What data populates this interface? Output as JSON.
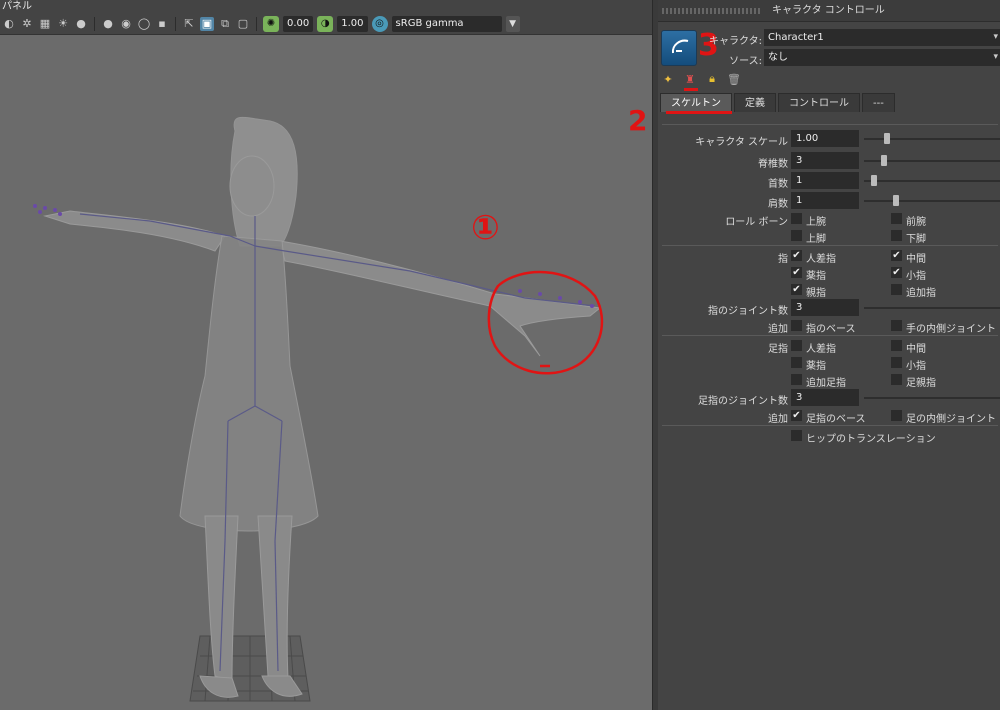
{
  "viewport": {
    "menu_label": "パネル",
    "exposure_value": "0.00",
    "gamma_value": "1.00",
    "colorspace": "sRGB gamma"
  },
  "panel": {
    "title": "キャラクタ コントロール",
    "character_label": "キャラクタ:",
    "character_value": "Character1",
    "source_label": "ソース:",
    "source_value": "なし",
    "tabs": [
      "スケルトン",
      "定義",
      "コントロール",
      "---"
    ],
    "active_tab": "スケルトン"
  },
  "skeleton": {
    "char_scale_label": "キャラクタ スケール",
    "char_scale_value": "1.00",
    "char_scale_fraction": 0.15,
    "spine_label": "脊椎数",
    "spine_value": "3",
    "spine_fraction": 0.13,
    "neck_label": "首数",
    "neck_value": "1",
    "neck_fraction": 0.05,
    "shoulder_label": "肩数",
    "shoulder_value": "1",
    "shoulder_fraction": 0.22,
    "roll_bone_label": "ロール ボーン",
    "roll_bones": [
      {
        "label": "上腕",
        "checked": false
      },
      {
        "label": "前腕",
        "checked": false
      },
      {
        "label": "上脚",
        "checked": false
      },
      {
        "label": "下脚",
        "checked": false
      }
    ],
    "fingers_label": "指",
    "fingers": [
      {
        "label": "人差指",
        "checked": true
      },
      {
        "label": "中間",
        "checked": true
      },
      {
        "label": "薬指",
        "checked": true
      },
      {
        "label": "小指",
        "checked": true
      },
      {
        "label": "親指",
        "checked": true
      },
      {
        "label": "追加指",
        "checked": false
      }
    ],
    "finger_joints_label": "指のジョイント数",
    "finger_joints_value": "3",
    "finger_add_label": "追加",
    "finger_adds": [
      {
        "label": "指のベース",
        "checked": false
      },
      {
        "label": "手の内側ジョイント",
        "checked": false
      }
    ],
    "toes_label": "足指",
    "toes": [
      {
        "label": "人差指",
        "checked": false
      },
      {
        "label": "中間",
        "checked": false
      },
      {
        "label": "薬指",
        "checked": false
      },
      {
        "label": "小指",
        "checked": false
      },
      {
        "label": "追加足指",
        "checked": false
      },
      {
        "label": "足親指",
        "checked": false
      }
    ],
    "toe_joints_label": "足指のジョイント数",
    "toe_joints_value": "3",
    "toe_add_label": "追加",
    "toe_adds": [
      {
        "label": "足指のベース",
        "checked": true
      },
      {
        "label": "足の内側ジョイント",
        "checked": false
      }
    ],
    "hip_translation_label": "ヒップのトランスレーション",
    "hip_translation_checked": false
  },
  "annotations": {
    "one": "①",
    "two": "2",
    "three": "3"
  },
  "colors": {
    "annotation": "#e01414",
    "accent": "#5285a6"
  }
}
